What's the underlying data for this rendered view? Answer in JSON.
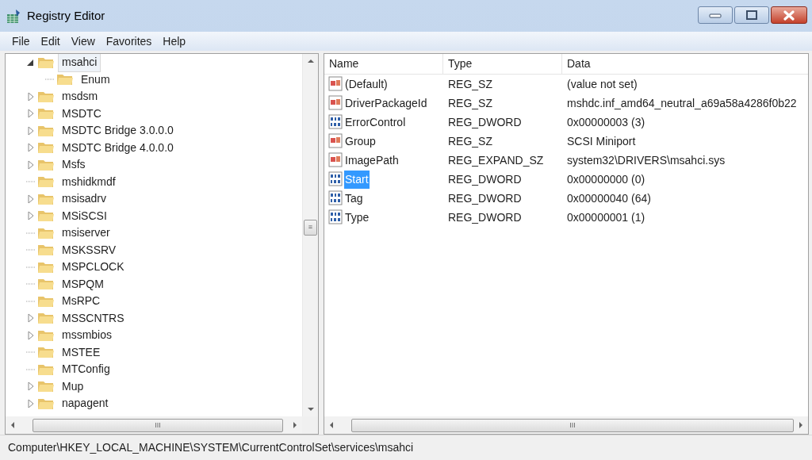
{
  "window": {
    "title": "Registry Editor"
  },
  "menu": [
    "File",
    "Edit",
    "View",
    "Favorites",
    "Help"
  ],
  "tree": [
    {
      "label": "msahci",
      "kind": "branch",
      "expanded": true,
      "selected": true,
      "children": [
        {
          "label": "Enum",
          "kind": "leaf",
          "selected": false
        }
      ]
    },
    {
      "label": "msdsm",
      "kind": "branch",
      "expanded": false,
      "selected": false
    },
    {
      "label": "MSDTC",
      "kind": "branch",
      "expanded": false,
      "selected": false
    },
    {
      "label": "MSDTC Bridge 3.0.0.0",
      "kind": "branch",
      "expanded": false,
      "selected": false
    },
    {
      "label": "MSDTC Bridge 4.0.0.0",
      "kind": "branch",
      "expanded": false,
      "selected": false
    },
    {
      "label": "Msfs",
      "kind": "branch",
      "expanded": false,
      "selected": false
    },
    {
      "label": "mshidkmdf",
      "kind": "leaf",
      "selected": false
    },
    {
      "label": "msisadrv",
      "kind": "branch",
      "expanded": false,
      "selected": false
    },
    {
      "label": "MSiSCSI",
      "kind": "branch",
      "expanded": false,
      "selected": false
    },
    {
      "label": "msiserver",
      "kind": "leaf",
      "selected": false
    },
    {
      "label": "MSKSSRV",
      "kind": "leaf",
      "selected": false
    },
    {
      "label": "MSPCLOCK",
      "kind": "leaf",
      "selected": false
    },
    {
      "label": "MSPQM",
      "kind": "leaf",
      "selected": false
    },
    {
      "label": "MsRPC",
      "kind": "leaf",
      "selected": false
    },
    {
      "label": "MSSCNTRS",
      "kind": "branch",
      "expanded": false,
      "selected": false
    },
    {
      "label": "mssmbios",
      "kind": "branch",
      "expanded": false,
      "selected": false
    },
    {
      "label": "MSTEE",
      "kind": "leaf",
      "selected": false
    },
    {
      "label": "MTConfig",
      "kind": "leaf",
      "selected": false
    },
    {
      "label": "Mup",
      "kind": "branch",
      "expanded": false,
      "selected": false
    },
    {
      "label": "napagent",
      "kind": "branch",
      "expanded": false,
      "selected": false
    }
  ],
  "table": {
    "columns": [
      "Name",
      "Type",
      "Data"
    ],
    "rows": [
      {
        "kind": "string",
        "name": "(Default)",
        "type": "REG_SZ",
        "data": "(value not set)",
        "selected": false
      },
      {
        "kind": "string",
        "name": "DriverPackageId",
        "type": "REG_SZ",
        "data": "mshdc.inf_amd64_neutral_a69a58a4286f0b22",
        "selected": false
      },
      {
        "kind": "binary",
        "name": "ErrorControl",
        "type": "REG_DWORD",
        "data": "0x00000003 (3)",
        "selected": false
      },
      {
        "kind": "string",
        "name": "Group",
        "type": "REG_SZ",
        "data": "SCSI Miniport",
        "selected": false
      },
      {
        "kind": "string",
        "name": "ImagePath",
        "type": "REG_EXPAND_SZ",
        "data": "system32\\DRIVERS\\msahci.sys",
        "selected": false
      },
      {
        "kind": "binary",
        "name": "Start",
        "type": "REG_DWORD",
        "data": "0x00000000 (0)",
        "selected": true
      },
      {
        "kind": "binary",
        "name": "Tag",
        "type": "REG_DWORD",
        "data": "0x00000040 (64)",
        "selected": false
      },
      {
        "kind": "binary",
        "name": "Type",
        "type": "REG_DWORD",
        "data": "0x00000001 (1)",
        "selected": false
      }
    ]
  },
  "scroll_thumb_glyph": [
    "≡",
    "III",
    "III"
  ],
  "status_bar": "Computer\\HKEY_LOCAL_MACHINE\\SYSTEM\\CurrentControlSet\\services\\msahci"
}
